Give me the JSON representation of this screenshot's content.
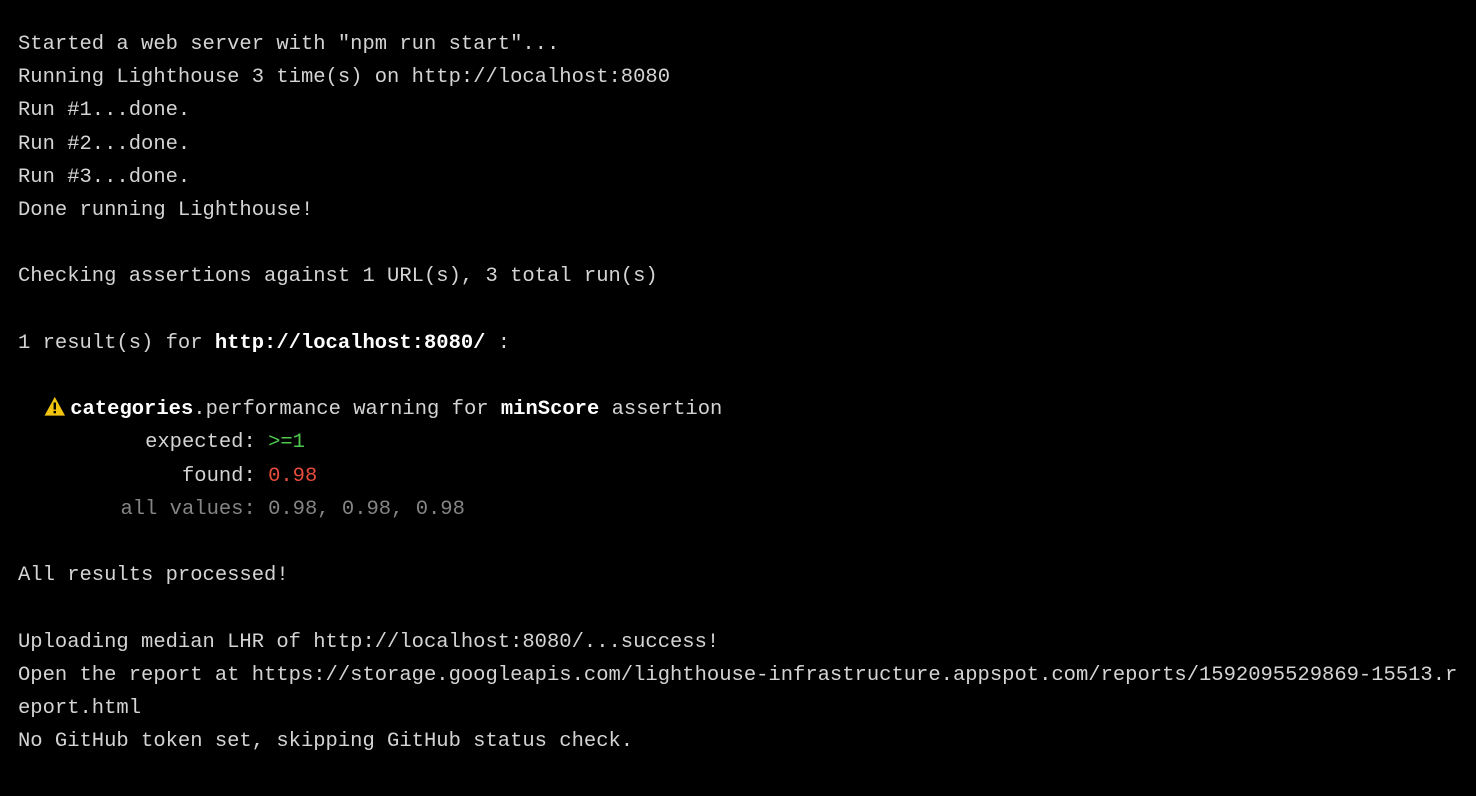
{
  "terminal": {
    "lines": {
      "start_server": "Started a web server with \"npm run start\"...",
      "running_lh": "Running Lighthouse 3 time(s) on http://localhost:8080",
      "run1": "Run #1...done.",
      "run2": "Run #2...done.",
      "run3": "Run #3...done.",
      "done_running": "Done running Lighthouse!",
      "checking": "Checking assertions against 1 URL(s), 3 total run(s)",
      "results_for_prefix": "1 result(s) for ",
      "results_for_url": "http://localhost:8080/",
      "results_for_suffix": " :",
      "result": {
        "category_key": "categories",
        "dot": ".",
        "audit": "performance",
        "mid": " warning for ",
        "assertion_key": "minScore",
        "tail": " assertion",
        "expected_label": "expected:",
        "expected_value": " >=1",
        "found_label": "found:",
        "found_value": " 0.98",
        "all_values_label": "all values:",
        "all_values_value": " 0.98, 0.98, 0.98"
      },
      "processed": "All results processed!",
      "uploading": "Uploading median LHR of http://localhost:8080/...success!",
      "open_report": "Open the report at https://storage.googleapis.com/lighthouse-infrastructure.appspot.com/reports/1592095529869-15513.report.html",
      "no_token": "No GitHub token set, skipping GitHub status check."
    }
  }
}
